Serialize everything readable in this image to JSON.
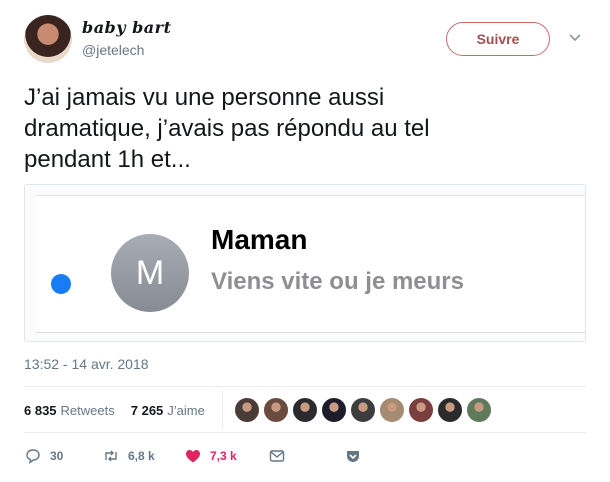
{
  "user": {
    "display_name": "baby bart",
    "handle": "@jetelech",
    "follow_label": "Suivre"
  },
  "tweet": {
    "text": "J’ai jamais vu une personne aussi\ndramatique, j’avais pas répondu au tel\npendant 1h et...",
    "timestamp": "13:52 - 14 avr. 2018"
  },
  "media": {
    "contact_initial": "M",
    "contact_name": "Maman",
    "message_preview": "Viens vite ou je meurs",
    "unread_color": "#1a7cf5"
  },
  "stats": {
    "retweets_count": "6 835",
    "retweets_label": "Retweets",
    "likes_count": "7 265",
    "likes_label": "J’aime"
  },
  "likers": [
    {
      "color": "#4a3b38"
    },
    {
      "color": "#6b4b3f"
    },
    {
      "color": "#2c2a2e"
    },
    {
      "color": "#1c1c2a"
    },
    {
      "color": "#3d3d3d"
    },
    {
      "color": "#a58b70"
    },
    {
      "color": "#7a3e3e"
    },
    {
      "color": "#2b2b2b"
    },
    {
      "color": "#5e7a5a"
    }
  ],
  "actions": {
    "reply_count": "30",
    "retweet_count": "6,8 k",
    "like_count": "7,3 k",
    "like_color": "#e0245e"
  }
}
